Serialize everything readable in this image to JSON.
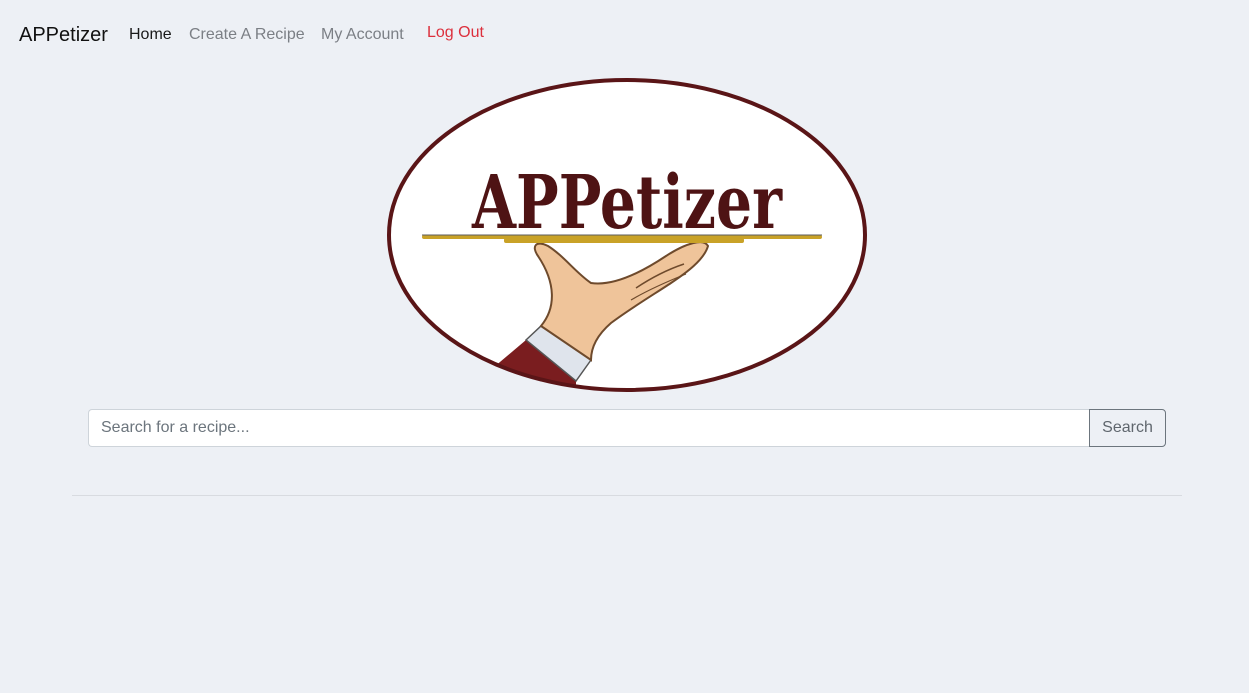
{
  "nav": {
    "brand": "APPetizer",
    "links": [
      {
        "label": "Home",
        "active": true
      },
      {
        "label": "Create A Recipe",
        "active": false
      },
      {
        "label": "My Account",
        "active": false
      }
    ],
    "logout_label": "Log Out"
  },
  "logo": {
    "text": "APPetizer",
    "text_color": "#4e1314",
    "border_color": "#5a1517",
    "tray_color": "#c9a227",
    "hand_color": "#efc49a",
    "sleeve_color": "#7a1d1f"
  },
  "search": {
    "placeholder": "Search for a recipe...",
    "value": "",
    "button_label": "Search"
  },
  "colors": {
    "background": "#edf0f5",
    "logout": "#dc2f3c"
  }
}
